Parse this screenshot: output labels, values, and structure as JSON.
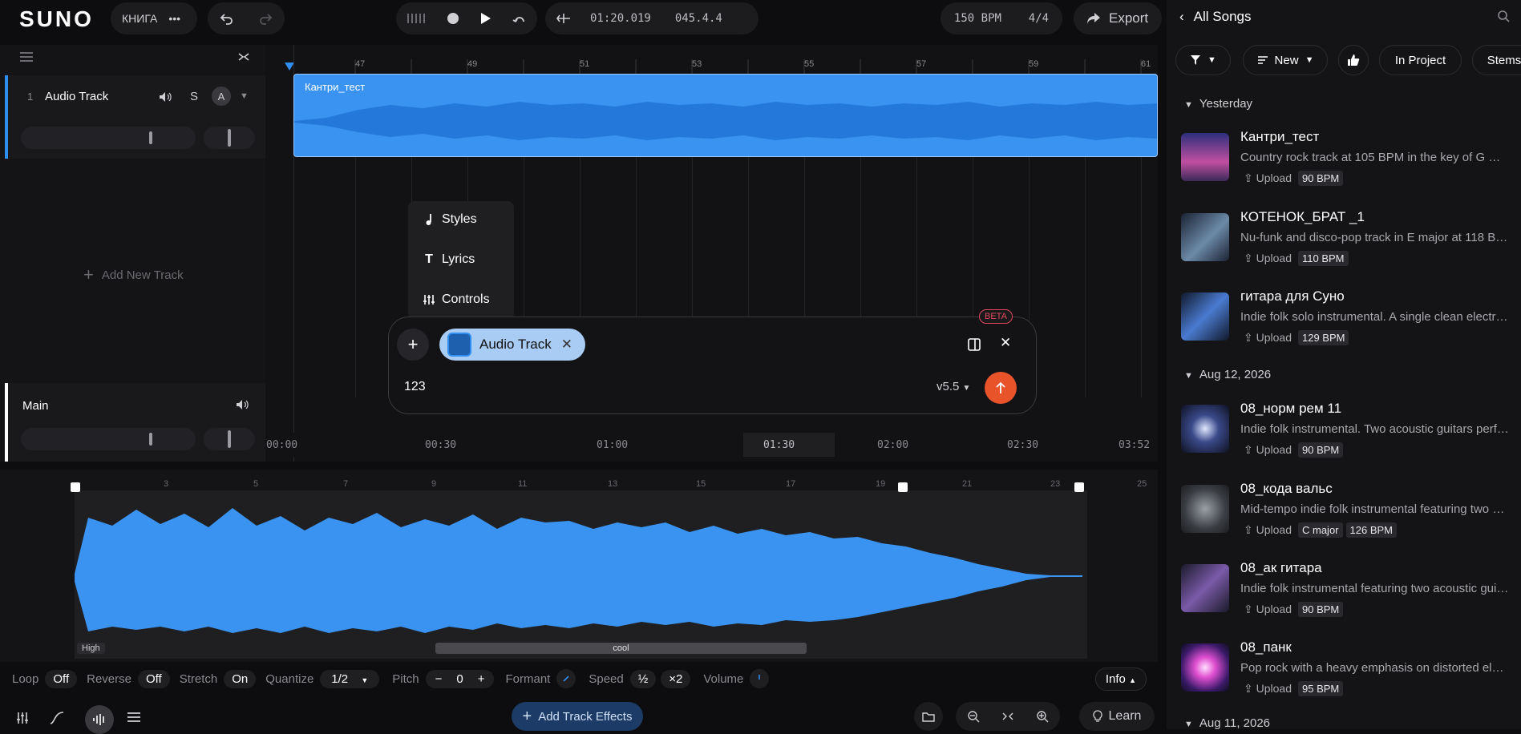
{
  "app": {
    "logo": "SUNO",
    "project": "КНИГА"
  },
  "transport": {
    "time": "01:20.019",
    "bars": "045.4.4",
    "tempo": "150 BPM",
    "meter": "4/4",
    "export": "Export"
  },
  "tracks": [
    {
      "number": "1",
      "name": "Audio Track",
      "solo": "S",
      "auto": "A"
    }
  ],
  "add_track": "Add New Track",
  "main_track": "Main",
  "ruler": [
    "47",
    "49",
    "51",
    "53",
    "55",
    "57",
    "59",
    "61"
  ],
  "clip": {
    "name": "Кантри_тест"
  },
  "time_ruler": [
    "00:00",
    "00:30",
    "01:00",
    "01:30",
    "02:00",
    "02:30",
    "03:52"
  ],
  "popup_menu": [
    {
      "label": "Styles",
      "icon": "music-note-icon"
    },
    {
      "label": "Lyrics",
      "icon": "text-icon"
    },
    {
      "label": "Controls",
      "icon": "sliders-icon"
    }
  ],
  "prompt": {
    "beta": "BETA",
    "chip": "Audio Track",
    "text": "123",
    "model": "v5.5"
  },
  "editor_ruler": [
    "3",
    "5",
    "7",
    "9",
    "11",
    "13",
    "15",
    "17",
    "19",
    "21",
    "23",
    "25"
  ],
  "editor_labels": {
    "high": "High",
    "cool": "cool"
  },
  "controls": {
    "loop_l": "Loop",
    "loop_v": "Off",
    "reverse_l": "Reverse",
    "reverse_v": "Off",
    "stretch_l": "Stretch",
    "stretch_v": "On",
    "quantize_l": "Quantize",
    "quantize_v": "1/2",
    "pitch_l": "Pitch",
    "pitch_v": "0",
    "formant_l": "Formant",
    "speed_l": "Speed",
    "speed_half": "½",
    "speed_double": "×2",
    "volume_l": "Volume",
    "info": "Info"
  },
  "bottom": {
    "add_effects": "Add Track Effects",
    "learn": "Learn"
  },
  "songs_panel": {
    "title": "All Songs",
    "filters": {
      "sort": "New",
      "in_project": "In Project",
      "stems": "Stems"
    },
    "sections": [
      "Yesterday",
      "Aug 12, 2026",
      "Aug 11, 2026"
    ],
    "songs": [
      {
        "title": "Кантри_тест",
        "desc": "Country rock track at 105 BPM in the key of G major...",
        "upload": "Upload",
        "tags": [
          "90 BPM"
        ]
      },
      {
        "title": "КОТЕНОК_БРАТ _1",
        "desc": "Nu-funk and disco-pop track in E major at 118 BPM. ...",
        "upload": "Upload",
        "tags": [
          "110 BPM"
        ]
      },
      {
        "title": "гитара для Суно",
        "desc": "Indie folk solo instrumental. A single clean electric g...",
        "upload": "Upload",
        "tags": [
          "129 BPM"
        ]
      },
      {
        "title": "08_норм рем 11",
        "desc": "Indie folk instrumental. Two acoustic guitars perfor...",
        "upload": "Upload",
        "tags": [
          "90 BPM"
        ]
      },
      {
        "title": "08_кода вальс",
        "desc": "Mid-tempo indie folk instrumental featuring two clea...",
        "upload": "Upload",
        "tags": [
          "C major",
          "126 BPM"
        ]
      },
      {
        "title": "08_ак гитара",
        "desc": "Indie folk instrumental featuring two acoustic guitar...",
        "upload": "Upload",
        "tags": [
          "90 BPM"
        ]
      },
      {
        "title": "08_панк",
        "desc": "Pop rock with a heavy emphasis on distorted electri...",
        "upload": "Upload",
        "tags": [
          "95 BPM"
        ]
      }
    ]
  },
  "colors": {
    "accent": "#2f8ef0",
    "clip": "#3a93f0",
    "record": "#e8532a",
    "beta": "#e0475e"
  }
}
